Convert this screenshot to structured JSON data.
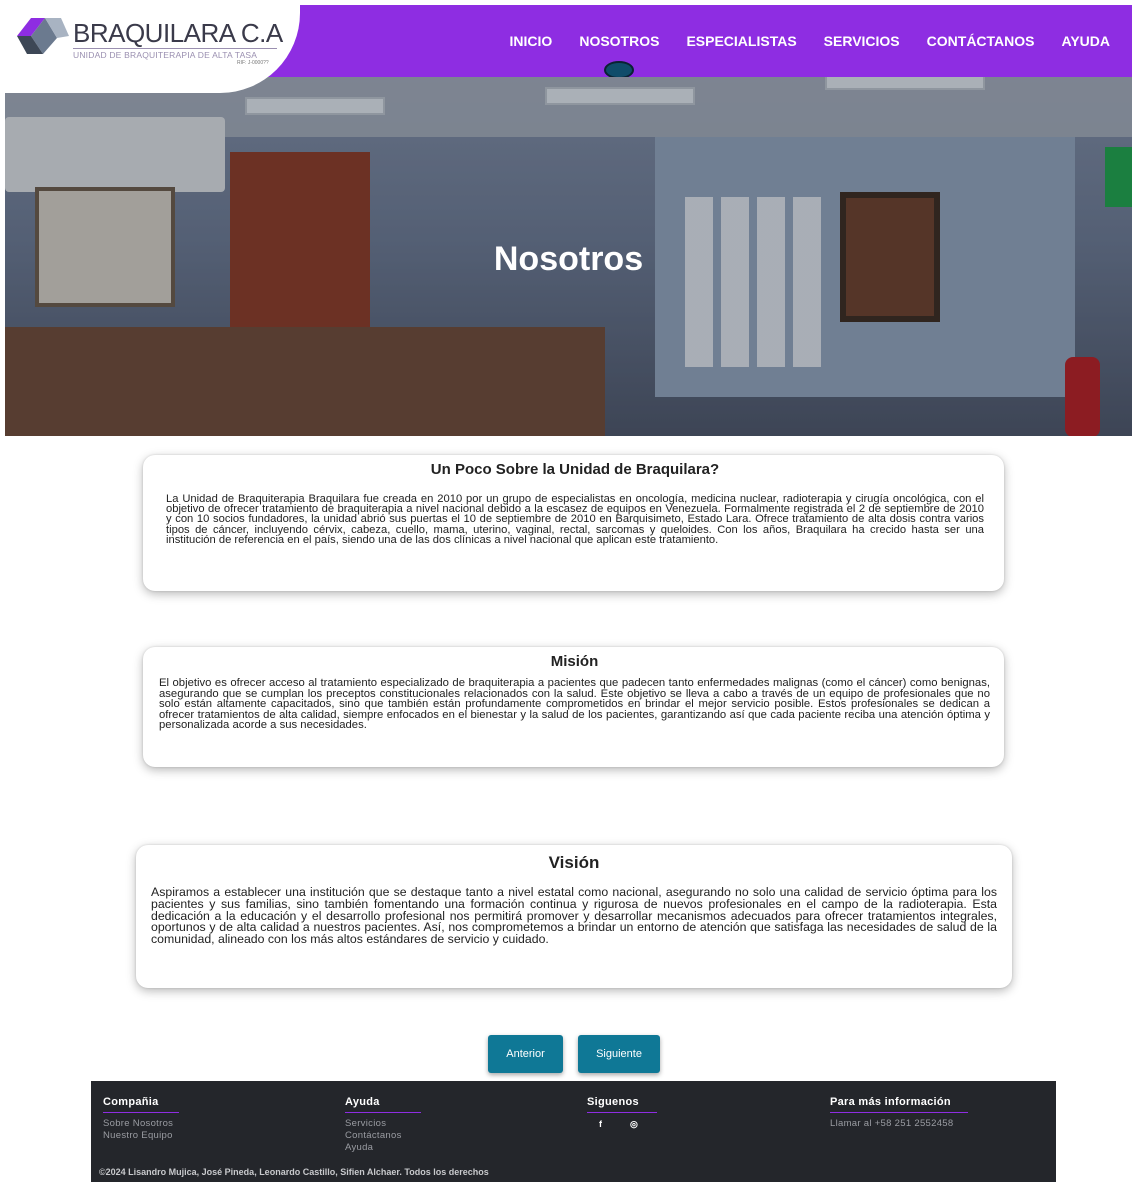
{
  "brand": {
    "name": "BRAQUILARA C.A",
    "tagline": "UNIDAD DE BRAQUITERAPIA DE ALTA TASA",
    "rif": "RIF: J-0000??",
    "colors": {
      "nav": "#8e2de2",
      "button": "#0f7896",
      "footer": "#24262b"
    }
  },
  "nav": {
    "items": [
      "INICIO",
      "NOSOTROS",
      "ESPECIALISTAS",
      "SERVICIOS",
      "CONTÁCTANOS",
      "AYUDA"
    ],
    "active": "NOSOTROS"
  },
  "hero": {
    "title": "Nosotros"
  },
  "about": {
    "title": "Un Poco Sobre la Unidad de Braquilara?",
    "body": "La Unidad de Braquiterapia Braquilara fue creada en 2010 por un grupo de especialistas en oncología, medicina nuclear, radioterapia y cirugía oncológica, con el objetivo de ofrecer tratamiento de braquiterapia a nivel nacional debido a la escasez de equipos en Venezuela. Formalmente registrada el 2 de septiembre de 2010 y con 10 socios fundadores, la unidad abrió sus puertas el 10 de septiembre de 2010 en Barquisimeto, Estado Lara. Ofrece tratamiento de alta dosis contra varios tipos de cáncer, incluyendo cérvix, cabeza, cuello, mama, uterino, vaginal, rectal, sarcomas y queloides. Con los años, Braquilara ha crecido hasta ser una institución de referencia en el país, siendo una de las dos clínicas a nivel nacional que aplican este tratamiento."
  },
  "mision": {
    "title": "Misión",
    "body": "El objetivo es ofrecer acceso al tratamiento especializado de braquiterapia a pacientes que padecen tanto enfermedades malignas (como el cáncer) como benignas, asegurando que se cumplan los preceptos constitucionales relacionados con la salud. Este objetivo se lleva a cabo a través de un equipo de profesionales que no solo están altamente capacitados, sino que también están profundamente comprometidos en brindar el mejor servicio posible. Estos profesionales se dedican a ofrecer tratamientos de alta calidad, siempre enfocados en el bienestar y la salud de los pacientes, garantizando así que cada paciente reciba una atención óptima y personalizada acorde a sus necesidades."
  },
  "vision": {
    "title": "Visión",
    "body": "Aspiramos a establecer una institución que se destaque tanto a nivel estatal como nacional, asegurando no solo una calidad de servicio óptima para los pacientes y sus familias, sino también fomentando una formación continua y rigurosa de nuevos profesionales en el campo de la radioterapia. Esta dedicación a la educación y el desarrollo profesional nos permitirá promover y desarrollar mecanismos adecuados para ofrecer tratamientos integrales, oportunos y de alta calidad a nuestros pacientes. Así, nos comprometemos a brindar un entorno de atención que satisfaga las necesidades de salud de la comunidad, alineado con los más altos estándares de servicio y cuidado."
  },
  "pager": {
    "prev": "Anterior",
    "next": "Siguiente"
  },
  "footer": {
    "col1": {
      "title": "Compañia",
      "links": [
        "Sobre Nosotros",
        "Nuestro Equipo"
      ]
    },
    "col2": {
      "title": "Ayuda",
      "links": [
        "Servicios",
        "Contáctanos",
        "Ayuda"
      ]
    },
    "col3": {
      "title": "Siguenos",
      "icons": [
        "facebook-icon",
        "instagram-icon"
      ],
      "glyphs": [
        "f",
        "◎"
      ]
    },
    "col4": {
      "title": "Para más información",
      "links": [
        "Llamar al +58 251 2552458"
      ]
    },
    "copyright": "©2024 Lisandro Mujica, José Pineda, Leonardo Castillo, Sifien Alchaer. Todos los derechos"
  }
}
